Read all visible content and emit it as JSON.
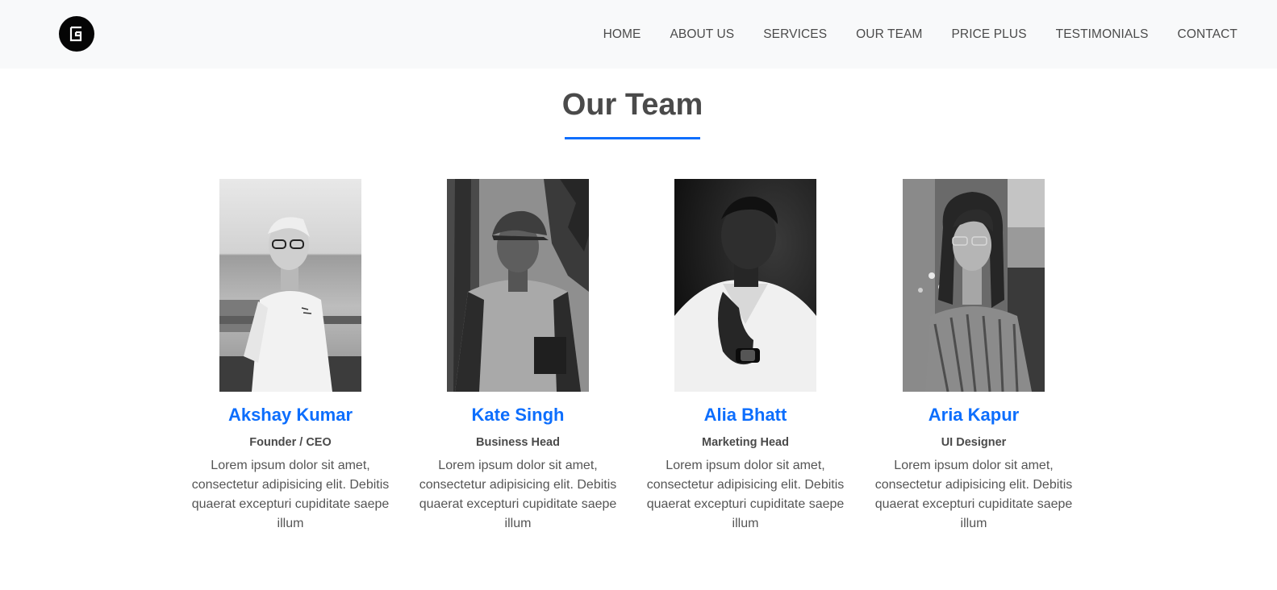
{
  "nav": {
    "items": [
      "HOME",
      "ABOUT US",
      "SERVICES",
      "OUR TEAM",
      "PRICE PLUS",
      "TESTIMONIALS",
      "CONTACT"
    ]
  },
  "section": {
    "title": "Our Team"
  },
  "team": [
    {
      "name": "Akshay Kumar",
      "role": "Founder / CEO",
      "description": "Lorem ipsum dolor sit amet, consectetur adipisicing elit. Debitis quaerat excepturi cupiditate saepe illum"
    },
    {
      "name": "Kate Singh",
      "role": "Business Head",
      "description": "Lorem ipsum dolor sit amet, consectetur adipisicing elit. Debitis quaerat excepturi cupiditate saepe illum"
    },
    {
      "name": "Alia Bhatt",
      "role": "Marketing Head",
      "description": "Lorem ipsum dolor sit amet, consectetur adipisicing elit. Debitis quaerat excepturi cupiditate saepe illum"
    },
    {
      "name": "Aria Kapur",
      "role": "UI Designer",
      "description": "Lorem ipsum dolor sit amet, consectetur adipisicing elit. Debitis quaerat excepturi cupiditate saepe illum"
    }
  ],
  "colors": {
    "accent": "#0d6efd",
    "navbar_bg": "#f8f9fa",
    "text": "#4a4a4a"
  },
  "icons": {
    "logo": "logo-icon"
  }
}
